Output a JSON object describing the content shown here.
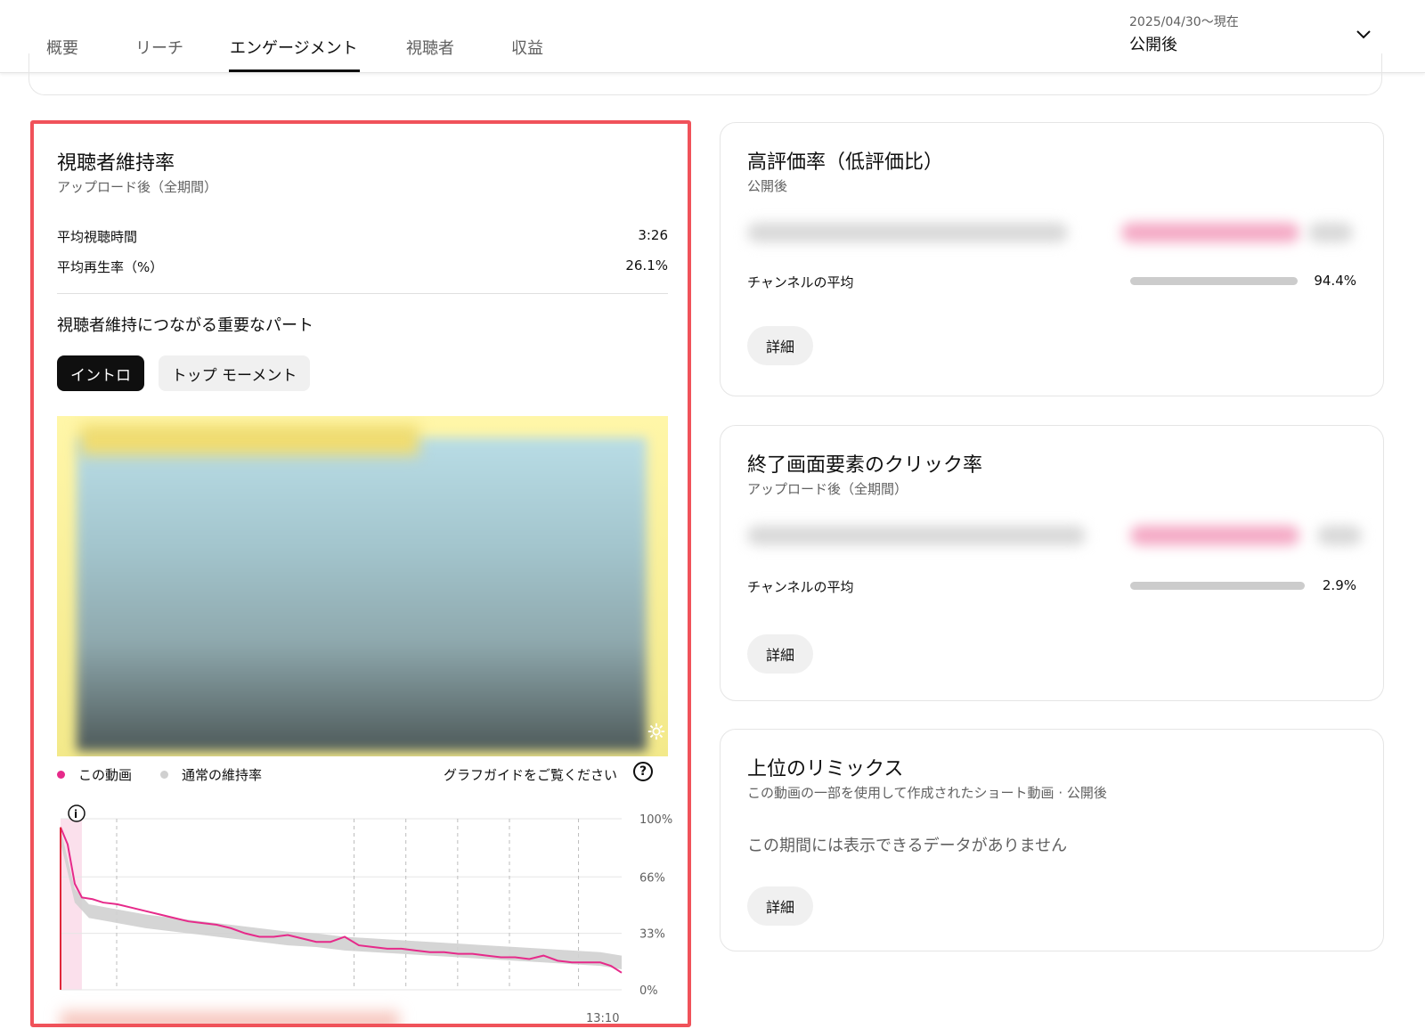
{
  "tabs": [
    {
      "label": "概要",
      "active": false
    },
    {
      "label": "リーチ",
      "active": false
    },
    {
      "label": "エンゲージメント",
      "active": true
    },
    {
      "label": "視聴者",
      "active": false
    },
    {
      "label": "収益",
      "active": false
    }
  ],
  "period": {
    "range": "2025/04/30〜現在",
    "label": "公開後",
    "icon": "chevron-down-icon"
  },
  "retention": {
    "title": "視聴者維持率",
    "subtitle": "アップロード後（全期間）",
    "avg_view_duration_label": "平均視聴時間",
    "avg_view_duration_value": "3:26",
    "avg_percent_viewed_label": "平均再生率（%）",
    "avg_percent_viewed_value": "26.1%",
    "key_moments_title": "視聴者維持につながる重要なパート",
    "chips": [
      {
        "label": "イントロ",
        "active": true
      },
      {
        "label": "トップ モーメント",
        "active": false
      }
    ],
    "legend_this_video": "この動画",
    "legend_typical": "通常の維持率",
    "graph_guide": "グラフガイドをご覧ください",
    "colors": {
      "this_video": "#e62a8a",
      "typical": "#d0d0d0",
      "intro_highlight": "#fbe0ec"
    }
  },
  "chart_data": {
    "type": "line",
    "xlabel": "",
    "ylabel": "",
    "y_tick_labels": [
      "100%",
      "66%",
      "33%",
      "0%"
    ],
    "x_tick_labels": [
      "13:10"
    ],
    "ylim": [
      0,
      100
    ],
    "xlim_seconds": [
      0,
      790
    ],
    "series": [
      {
        "name": "この動画",
        "x": [
          0,
          10,
          20,
          30,
          45,
          60,
          80,
          100,
          120,
          140,
          160,
          180,
          200,
          220,
          240,
          260,
          280,
          300,
          320,
          340,
          360,
          380,
          400,
          420,
          440,
          460,
          480,
          500,
          520,
          540,
          560,
          580,
          600,
          620,
          640,
          660,
          680,
          700,
          720,
          740,
          760,
          775,
          790
        ],
        "y": [
          95,
          85,
          62,
          54,
          53,
          51,
          50,
          48,
          46,
          44,
          42,
          40,
          39,
          38,
          36,
          33,
          31,
          31,
          32,
          30,
          28,
          28,
          31,
          26,
          25,
          24,
          24,
          23,
          22,
          22,
          21,
          21,
          20,
          19,
          19,
          18,
          20,
          17,
          16,
          16,
          16,
          14,
          10
        ]
      },
      {
        "name": "通常の維持率",
        "x": [
          0,
          20,
          40,
          80,
          120,
          160,
          200,
          240,
          280,
          320,
          360,
          400,
          440,
          480,
          520,
          560,
          600,
          640,
          680,
          720,
          760,
          790
        ],
        "y": [
          90,
          55,
          46,
          43,
          40,
          38,
          36,
          34,
          32,
          30,
          29,
          27,
          26,
          25,
          24,
          23,
          22,
          21,
          20,
          19,
          18,
          16
        ]
      }
    ],
    "legend": "top-left"
  },
  "likes_card": {
    "title": "高評価率（低評価比）",
    "subtitle": "公開後",
    "avg_label": "チャンネルの平均",
    "avg_value": "94.4%",
    "details": "詳細"
  },
  "endscreen_card": {
    "title": "終了画面要素のクリック率",
    "subtitle": "アップロード後（全期間）",
    "avg_label": "チャンネルの平均",
    "avg_value": "2.9%",
    "details": "詳細"
  },
  "remix_card": {
    "title": "上位のリミックス",
    "subtitle": "この動画の一部を使用して作成されたショート動画 · 公開後",
    "empty": "この期間には表示できるデータがありません",
    "details": "詳細"
  }
}
